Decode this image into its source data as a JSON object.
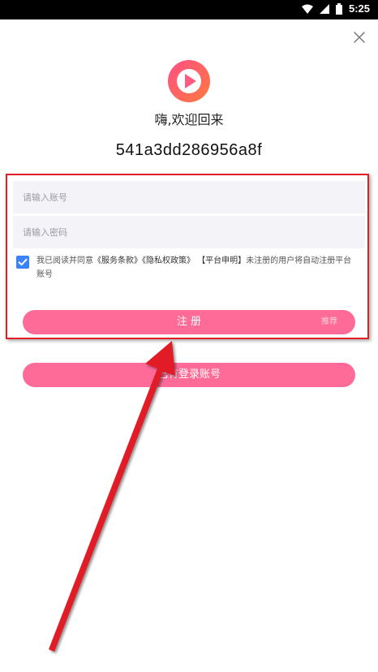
{
  "status_bar": {
    "time": "5:25",
    "icons": [
      "wifi-icon",
      "signal-icon",
      "battery-icon"
    ]
  },
  "header": {
    "greeting": "嗨,欢迎回来",
    "device_id": "541a3dd286956a8f"
  },
  "form": {
    "account_placeholder": "请输入账号",
    "password_placeholder": "请输入密码",
    "agreement": {
      "checked": true,
      "prefix": "我已阅读并同意",
      "terms": "《服务条款》",
      "privacy": "《隐私权政策》",
      "statement": "【平台申明】",
      "suffix": "未注册的用户将自动注册平台账号"
    },
    "register_label": "注 册",
    "register_badge": "推荐",
    "login_label": "已有登录账号"
  },
  "colors": {
    "accent": "#ff6b98",
    "checkbox": "#3a82f7",
    "annotation": "#e21f26"
  }
}
